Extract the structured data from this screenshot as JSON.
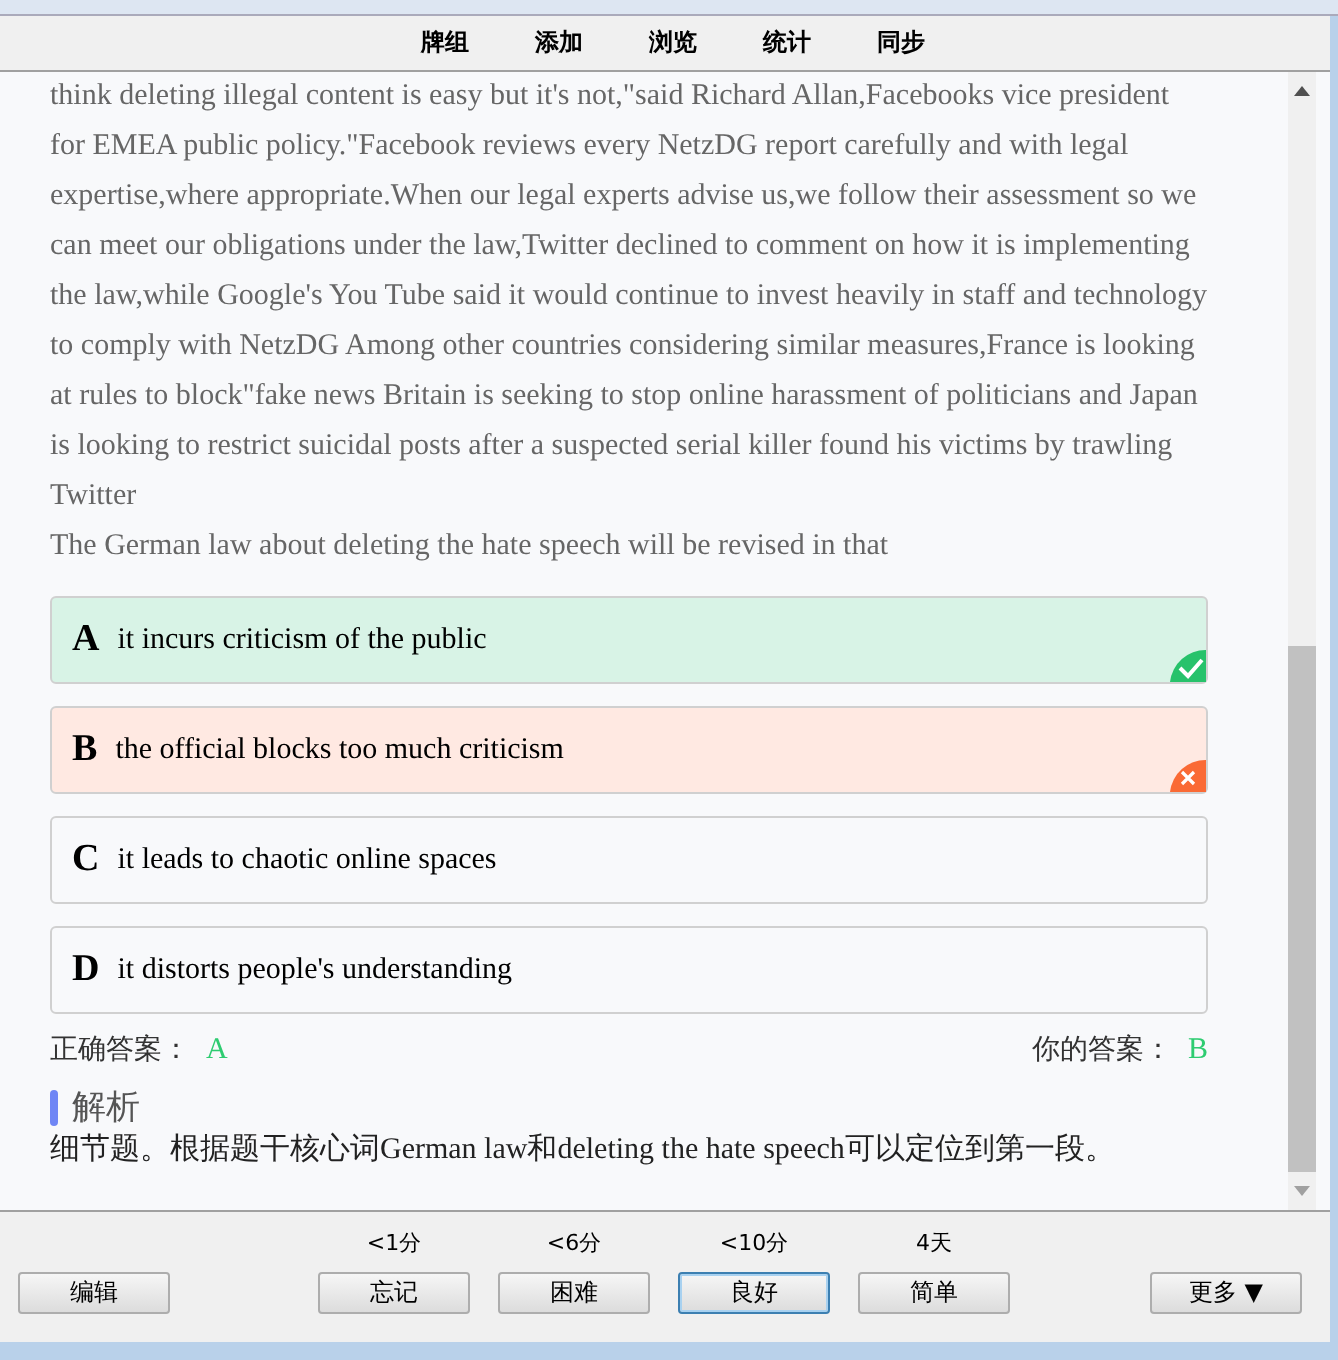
{
  "nav": {
    "tabs": [
      {
        "label": "牌组",
        "selected": false
      },
      {
        "label": "添加",
        "selected": false
      },
      {
        "label": "浏览",
        "selected": false
      },
      {
        "label": "统计",
        "selected": false
      },
      {
        "label": "同步",
        "selected": false
      }
    ]
  },
  "passage": "think deleting illegal content is easy but it's not,\"said Richard Allan,Facebooks vice president for EMEA public policy.\"Facebook reviews every NetzDG report carefully and with legal expertise,where appropriate.When our legal experts advise us,we follow their assessment so we can meet our obligations under the law,Twitter declined to comment on how it is implementing the law,while Google's You Tube said it would continue to invest heavily in staff and technology to comply with NetzDG Among other countries considering similar measures,France is looking at rules to block\"fake news Britain is seeking to stop online harassment of politicians and Japan is looking to restrict suicidal posts after a suspected serial killer found his victims by trawling Twitter",
  "question": "The German law about deleting the hate speech will be revised in that",
  "options": [
    {
      "letter": "A",
      "text": "it incurs criticism of the public",
      "kind": "correct"
    },
    {
      "letter": "B",
      "text": "the official blocks too much criticism",
      "kind": "wrong"
    },
    {
      "letter": "C",
      "text": "it leads to chaotic online spaces",
      "kind": "plain"
    },
    {
      "letter": "D",
      "text": "it distorts people's understanding",
      "kind": "plain"
    }
  ],
  "correct_answer": {
    "label": "正确答案：",
    "value": "A"
  },
  "your_answer": {
    "label": "你的答案：",
    "value": "B"
  },
  "analysis": {
    "title": "解析",
    "text": "细节题。根据题干核心词German law和deleting the hate speech可以定位到第一段。"
  },
  "bottom_bar": {
    "edit": "编辑",
    "more": "更多 ▼",
    "ratings": [
      {
        "interval": "<1分",
        "label": "忘记",
        "selected": false
      },
      {
        "interval": "<6分",
        "label": "困难",
        "selected": false
      },
      {
        "interval": "<10分",
        "label": "良好",
        "selected": true
      },
      {
        "interval": "4天",
        "label": "简单",
        "selected": false
      }
    ]
  }
}
